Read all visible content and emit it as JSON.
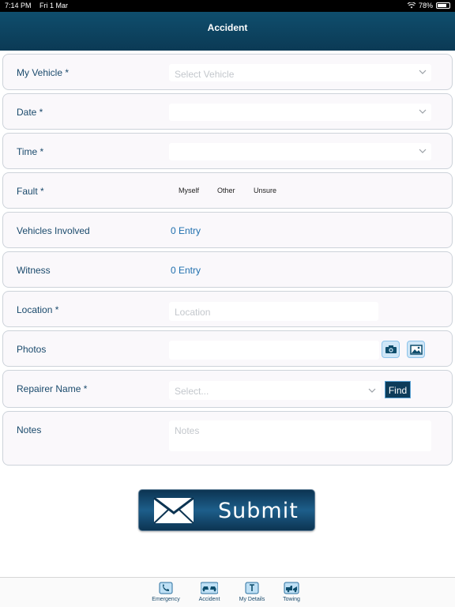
{
  "status": {
    "time": "7:14 PM",
    "date": "Fri 1 Mar",
    "battery": "78%"
  },
  "header": {
    "title": "Accident"
  },
  "form": {
    "vehicle": {
      "label": "My Vehicle *",
      "placeholder": "Select Vehicle"
    },
    "date": {
      "label": "Date *"
    },
    "time": {
      "label": "Time *"
    },
    "fault": {
      "label": "Fault *",
      "options": [
        "Myself",
        "Other",
        "Unsure"
      ]
    },
    "vehicles_involved": {
      "label": "Vehicles Involved",
      "value": "0 Entry"
    },
    "witness": {
      "label": "Witness",
      "value": "0 Entry"
    },
    "location": {
      "label": "Location *",
      "placeholder": "Location"
    },
    "photos": {
      "label": "Photos"
    },
    "repairer": {
      "label": "Repairer Name *",
      "placeholder": "Select...",
      "find_label": "Find"
    },
    "notes": {
      "label": "Notes",
      "placeholder": "Notes"
    }
  },
  "submit": {
    "label": "Submit"
  },
  "tabbar": {
    "items": [
      {
        "label": "Emergency",
        "icon": "phone-icon"
      },
      {
        "label": "Accident",
        "icon": "car-crash-icon"
      },
      {
        "label": "My Details",
        "icon": "details-icon"
      },
      {
        "label": "Towing",
        "icon": "tow-truck-icon"
      }
    ]
  }
}
